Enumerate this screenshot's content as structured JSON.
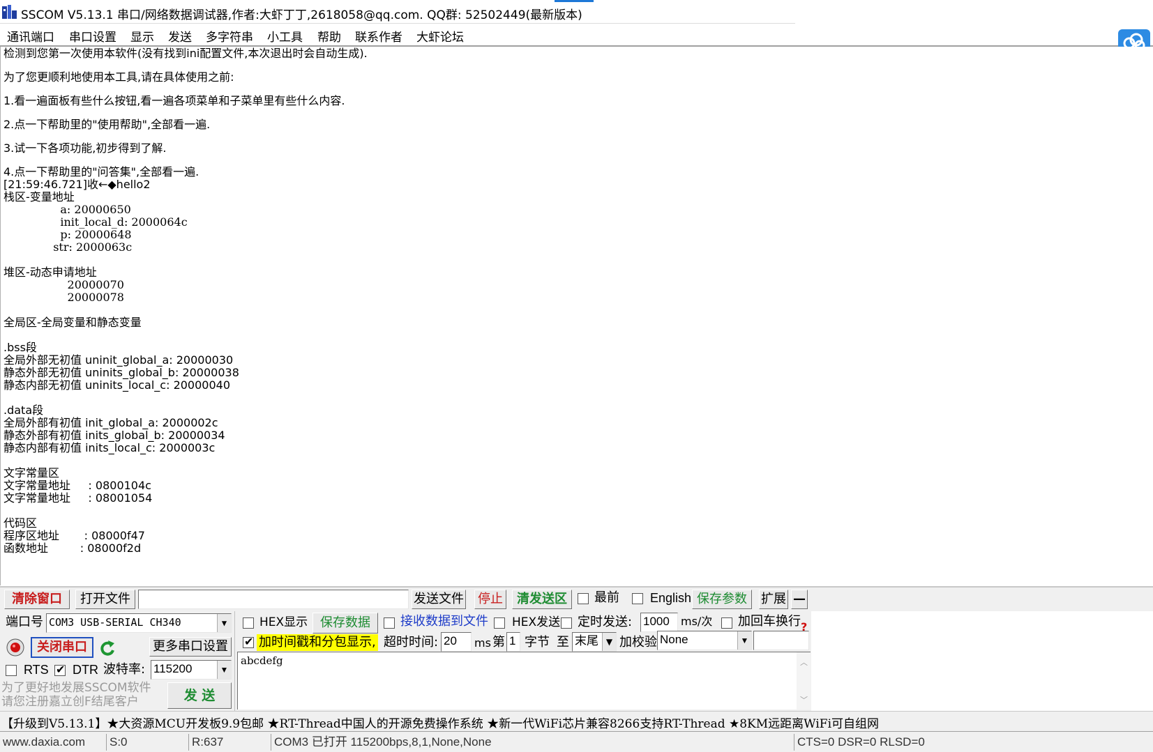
{
  "window": {
    "title": "SSCOM V5.13.1 串口/网络数据调试器,作者:大虾丁丁,2618058@qq.com. QQ群: 52502449(最新版本)"
  },
  "menu": {
    "items": [
      "通讯端口",
      "串口设置",
      "显示",
      "发送",
      "多字符串",
      "小工具",
      "帮助",
      "联系作者",
      "大虾论坛"
    ]
  },
  "receive": {
    "lines": [
      "检测到您第一次使用本软件(没有找到ini配置文件,本次退出时会自动生成).",
      "为了您更顺利地使用本工具,请在具体使用之前:",
      "1.看一遍面板有些什么按钮,看一遍各项菜单和子菜单里有些什么内容.",
      "2.点一下帮助里的\"使用帮助\",全部看一遍.",
      "3.试一下各项功能,初步得到了解.",
      "4.点一下帮助里的\"问答集\",全部看一遍.",
      "[21:59:46.721]收←◆hello2",
      "栈区-变量地址",
      "                a: 20000650",
      "                init_local_d: 2000064c",
      "                p: 20000648",
      "              str: 2000063c",
      "",
      "堆区-动态申请地址",
      "                  20000070",
      "                  20000078",
      "",
      "全局区-全局变量和静态变量",
      "",
      ".bss段",
      "全局外部无初值 uninit_global_a: 20000030",
      "静态外部无初值 uninits_global_b: 20000038",
      "静态内部无初值 uninits_local_c: 20000040",
      "",
      ".data段",
      "全局外部有初值 init_global_a: 2000002c",
      "静态外部有初值 inits_global_b: 20000034",
      "静态内部有初值 inits_local_c: 2000003c",
      "",
      "文字常量区",
      "文字常量地址     : 0800104c",
      "文字常量地址     : 08001054",
      "",
      "代码区",
      "程序区地址       : 08000f47",
      "函数地址         : 08000f2d"
    ]
  },
  "toolbar1": {
    "clear_window": "清除窗口",
    "open_file": "打开文件",
    "file_path": "",
    "send_file": "发送文件",
    "stop": "停止",
    "clear_send": "清发送区",
    "topmost": "最前",
    "english": "English",
    "save_params": "保存参数",
    "expand": "扩展",
    "collapse": "—"
  },
  "port": {
    "label": "端口号",
    "value": "COM3 USB-SERIAL CH340",
    "hex_display": "HEX显示",
    "save_data": "保存数据",
    "recv_to_file": "接收数据到文件",
    "hex_send": "HEX发送",
    "timed_send": "定时发送:",
    "interval": "1000",
    "interval_unit": "ms/次",
    "add_crlf": "加回车换行"
  },
  "row3": {
    "close_port": "关闭串口",
    "more_settings": "更多串口设置",
    "timestamp": "加时间戳和分包显示,",
    "timeout_label": "超时时间:",
    "timeout": "20",
    "ms": "ms",
    "nth": "第",
    "byte_index": "1",
    "byte_label": "字节",
    "to": "至",
    "end": "末尾",
    "checksum_label": "加校验",
    "checksum": "None"
  },
  "row4": {
    "rts": "RTS",
    "dtr": "DTR",
    "baud_label": "波特率:",
    "baud": "115200",
    "promo_line1": "为了更好地发展SSCOM软件",
    "promo_line2": "请您注册嘉立创F结尾客户",
    "send_button": "发  送",
    "send_text": "abcdefg"
  },
  "ad": {
    "text": "【升级到V5.13.1】★大资源MCU开发板9.9包邮 ★RT-Thread中国人的开源免费操作系统 ★新一代WiFi芯片兼容8266支持RT-Thread ★8KM远距离WiFi可自组网"
  },
  "status": {
    "site": "www.daxia.com",
    "sent": "S:0",
    "received": "R:637",
    "port_state": "COM3 已打开  115200bps,8,1,None,None",
    "signals": "CTS=0 DSR=0 RLSD=0"
  },
  "colors": {
    "accent_red": "#c81e1e",
    "accent_green": "#1e8c32",
    "accent_blue": "#1e3cc8",
    "highlight_yellow": "#ffff00",
    "cloud_blue": "#2d8be3"
  }
}
